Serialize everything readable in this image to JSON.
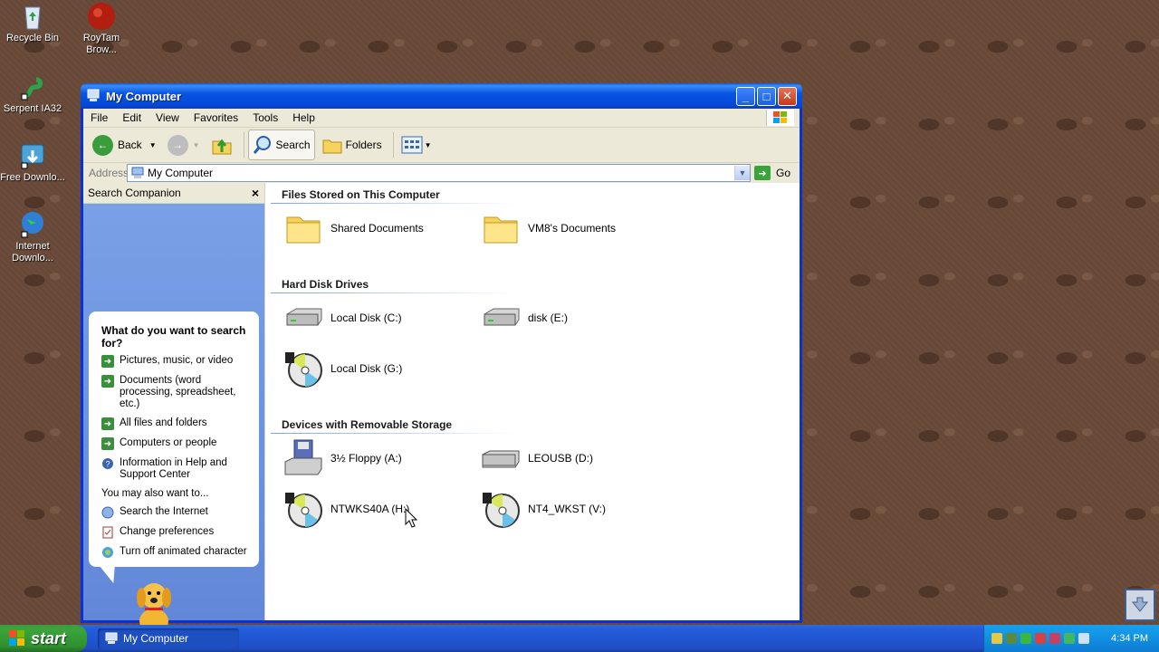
{
  "desktop": {
    "icons": [
      {
        "label": "Recycle Bin",
        "icon": "recycle-bin-icon"
      },
      {
        "label": "RoyTam Brow...",
        "icon": "browser-icon"
      },
      {
        "label": "Serpent IA32",
        "icon": "serpent-icon"
      },
      {
        "label": "Free Downlo...",
        "icon": "download-manager-icon"
      },
      {
        "label": "Internet Downlo...",
        "icon": "internet-download-icon"
      }
    ]
  },
  "window": {
    "title": "My Computer",
    "menu": [
      "File",
      "Edit",
      "View",
      "Favorites",
      "Tools",
      "Help"
    ],
    "toolbar": {
      "back": "Back",
      "search": "Search",
      "folders": "Folders"
    },
    "address": {
      "label": "Address",
      "value": "My Computer",
      "go": "Go"
    },
    "side_pane": {
      "title": "Search Companion",
      "question": "What do you want to search for?",
      "options": [
        "Pictures, music, or video",
        "Documents (word processing, spreadsheet, etc.)",
        "All files and folders",
        "Computers or people",
        "Information in Help and Support Center"
      ],
      "also_label": "You may also want to...",
      "also_options": [
        "Search the Internet",
        "Change preferences",
        "Turn off animated character"
      ]
    },
    "groups": [
      {
        "title": "Files Stored on This Computer",
        "items": [
          "Shared Documents",
          "VM8's Documents"
        ]
      },
      {
        "title": "Hard Disk Drives",
        "items": [
          "Local Disk (C:)",
          "disk (E:)",
          "Local Disk (G:)"
        ]
      },
      {
        "title": "Devices with Removable Storage",
        "items": [
          "3½ Floppy (A:)",
          "LEOUSB (D:)",
          "NTWKS40A (H:)",
          "NT4_WKST (V:)"
        ]
      }
    ]
  },
  "taskbar": {
    "start": "start",
    "task": "My Computer",
    "clock": "4:34 PM"
  },
  "colors": {
    "title_blue": "#0854e3",
    "taskbar_blue": "#245edb",
    "start_green": "#3aa43a"
  }
}
